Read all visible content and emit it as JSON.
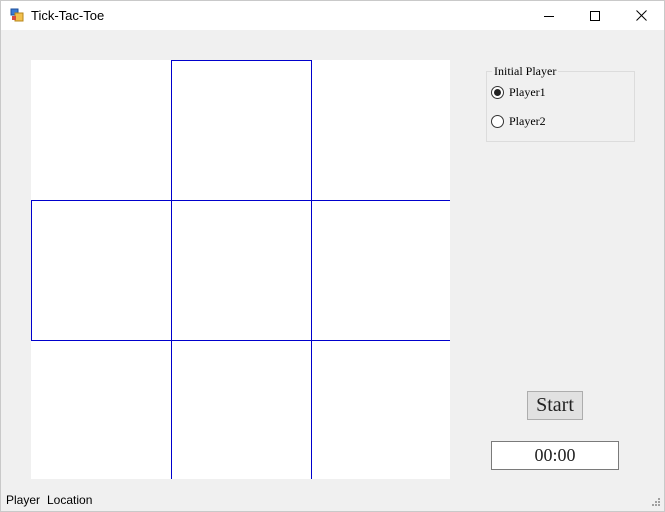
{
  "window": {
    "title": "Tick-Tac-Toe",
    "icons": {
      "app": "app-icon",
      "minimize": "minimize-icon",
      "maximize": "maximize-icon",
      "close": "close-icon"
    }
  },
  "board": {
    "grid_color": "#0000cc",
    "rows": 3,
    "cols": 3,
    "cells": [
      "",
      "",
      "",
      "",
      "",
      "",
      "",
      "",
      ""
    ]
  },
  "initial_player": {
    "label": "Initial Player",
    "options": [
      {
        "label": "Player1",
        "checked": true
      },
      {
        "label": "Player2",
        "checked": false
      }
    ]
  },
  "controls": {
    "start_label": "Start",
    "timer_value": "00:00"
  },
  "statusbar": {
    "player_label": "Player",
    "location_label": "Location"
  }
}
